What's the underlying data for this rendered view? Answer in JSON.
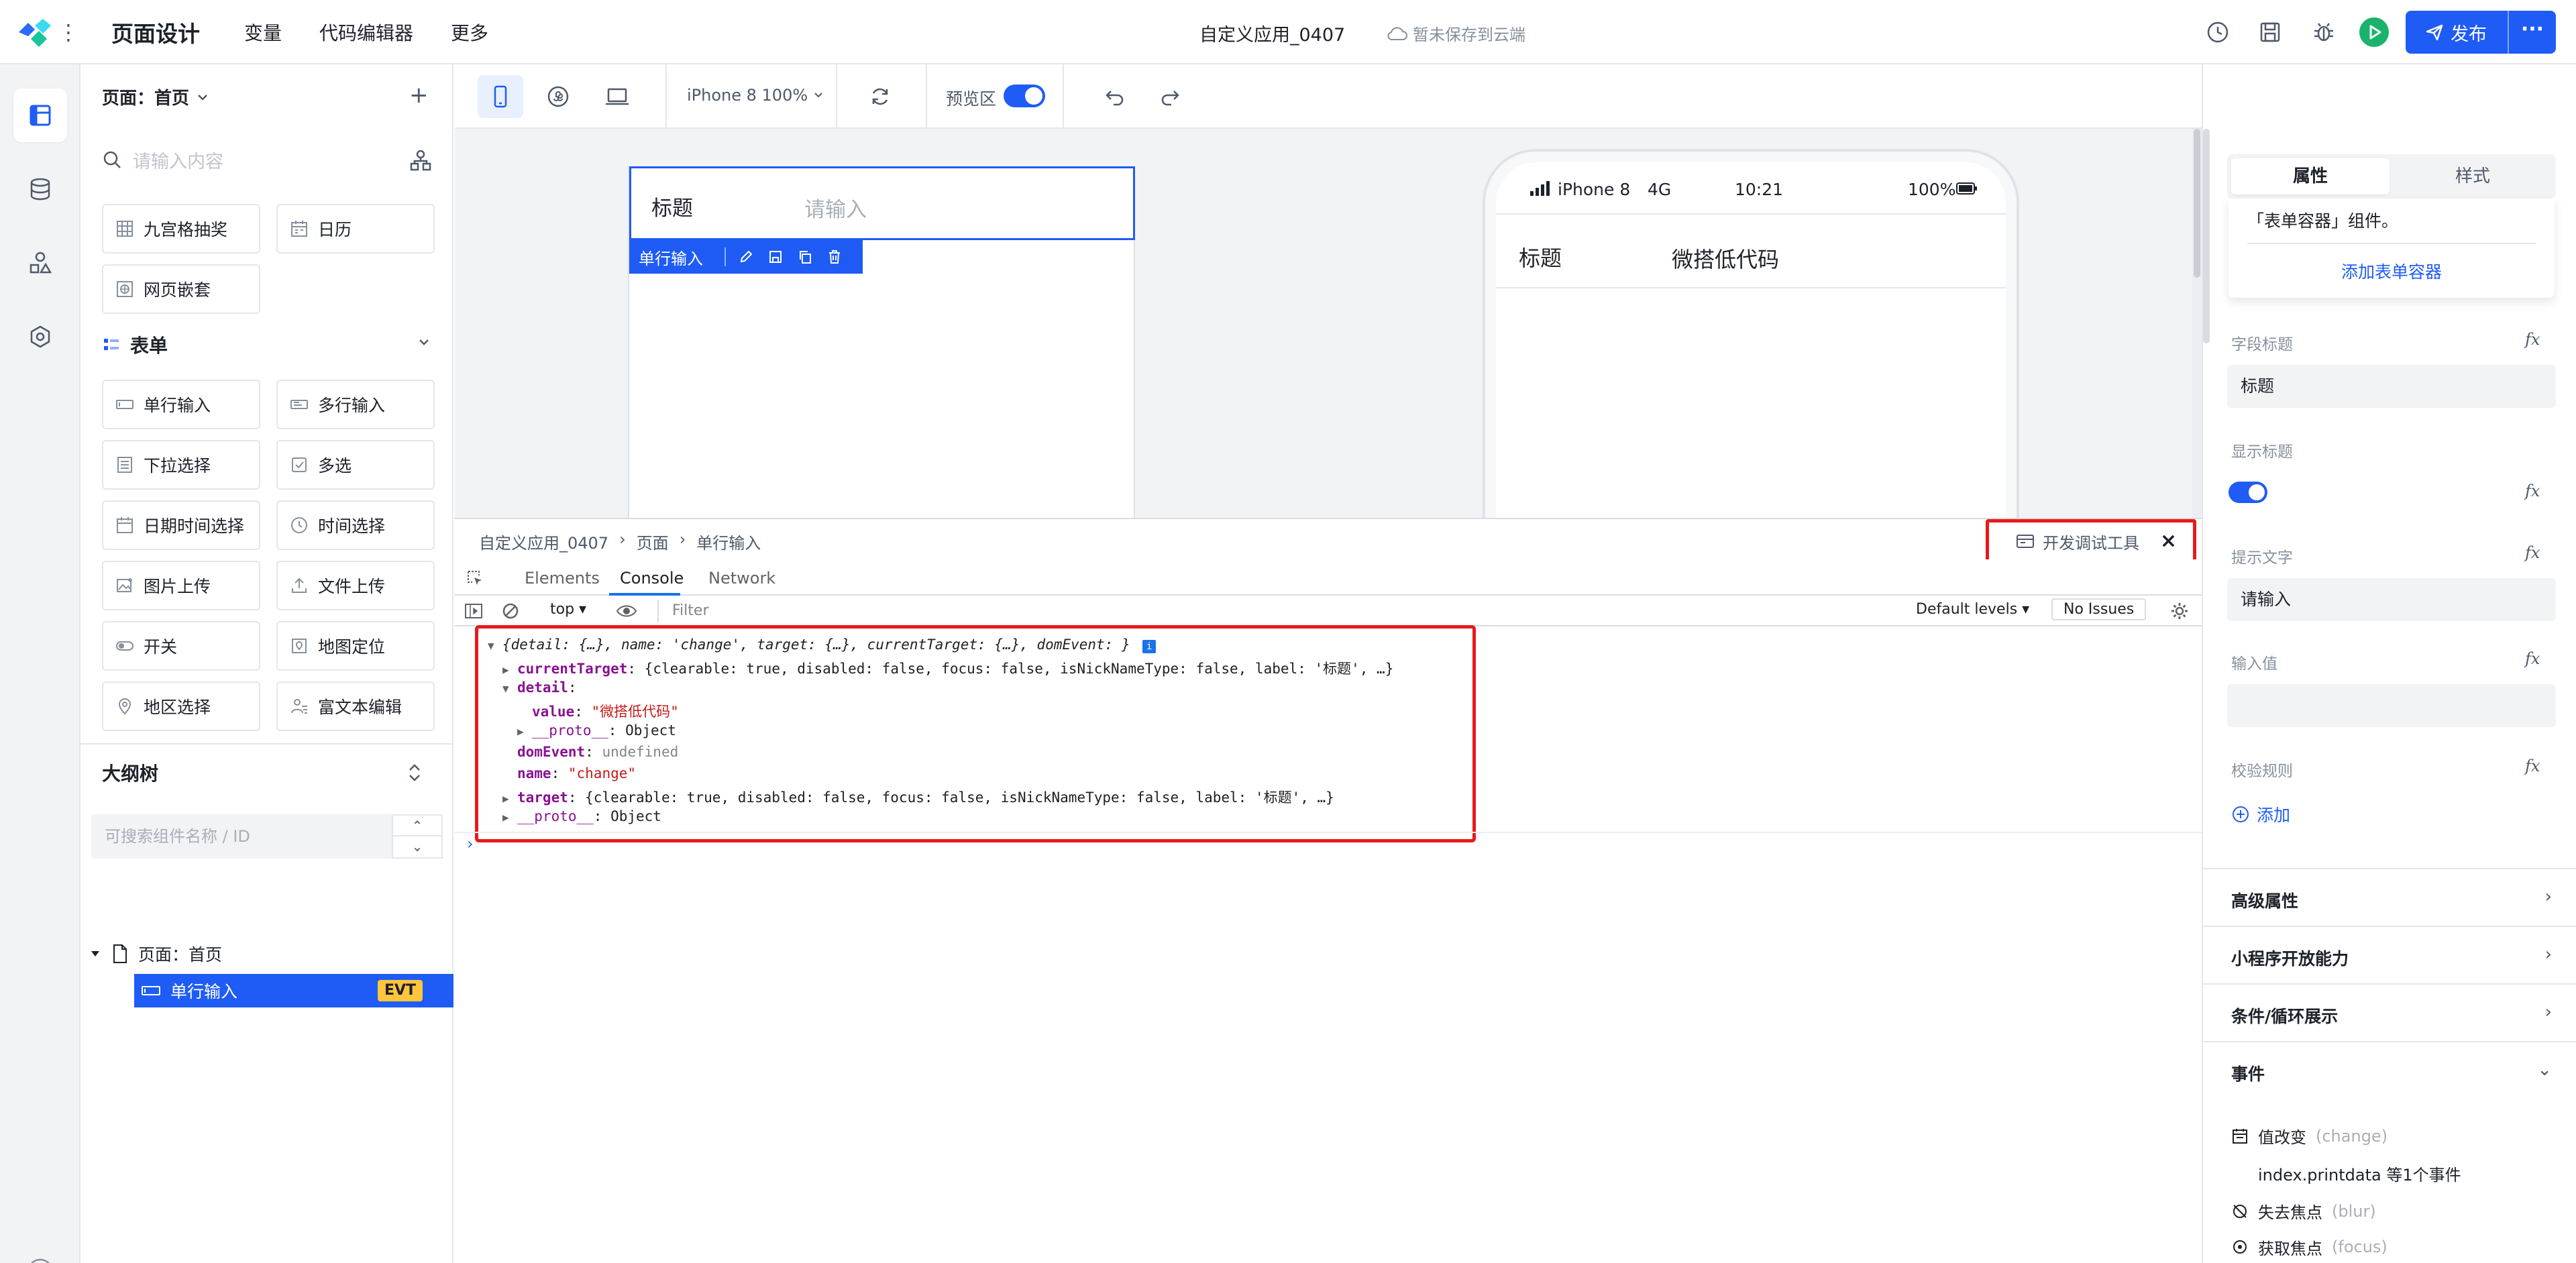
{
  "topbar": {
    "section_title": "页面设计",
    "nav": [
      "变量",
      "代码编辑器",
      "更多"
    ],
    "doc_title": "自定义应用_0407",
    "save_status": "暂未保存到云端",
    "publish_label": "发布",
    "publish_more": "···"
  },
  "left_panel": {
    "page_select": "页面：首页",
    "search_placeholder": "请输入内容",
    "components_top": [
      "九宫格抽奖",
      "日历",
      "网页嵌套"
    ],
    "group_form": "表单",
    "form_components": [
      "单行输入",
      "多行输入",
      "下拉选择",
      "多选",
      "日期时间选择",
      "时间选择",
      "图片上传",
      "文件上传",
      "开关",
      "地图定位",
      "地区选择",
      "富文本编辑"
    ],
    "outline_title": "大纲树",
    "outline_search_placeholder": "可搜索组件名称 / ID",
    "tree_page": "页面：首页",
    "tree_item": "单行输入",
    "tree_item_badge": "EVT"
  },
  "canvas_toolbar": {
    "device": "iPhone 8 100%",
    "preview_label": "预览区"
  },
  "canvas": {
    "field_title": "标题",
    "field_placeholder": "请输入",
    "selected_tag": "单行输入",
    "phone_status": {
      "device": "iPhone 8",
      "network": "4G",
      "time": "10:21",
      "battery": "100%"
    },
    "phone_label": "标题",
    "phone_value": "微搭低代码"
  },
  "devtools": {
    "breadcrumb": [
      "自定义应用_0407",
      "页面",
      "单行输入"
    ],
    "title": "开发调试工具",
    "tabs": [
      "Elements",
      "Console",
      "Network"
    ],
    "context": "top",
    "filter_placeholder": "Filter",
    "levels": "Default levels",
    "issues": "No Issues",
    "console": {
      "summary": "{detail: {…}, name: 'change', target: {…}, currentTarget: {…}, domEvent: }",
      "current_target_key": "currentTarget",
      "current_target_val": "{clearable: true, disabled: false, focus: false, isNickNameType: false, label: '标题', …}",
      "detail_key": "detail",
      "value_key": "value",
      "value_val": "\"微搭低代码\"",
      "proto_key": "__proto__",
      "proto_val": "Object",
      "dom_event_key": "domEvent",
      "dom_event_val": "undefined",
      "name_key": "name",
      "name_val": "\"change\"",
      "target_key": "target",
      "target_val": "{clearable: true, disabled: false, focus: false, isNickNameType: false, label: '标题', …}"
    }
  },
  "right_panel": {
    "tabs": [
      "属性",
      "样式"
    ],
    "tip_text": "「表单容器」组件。",
    "tip_link": "添加表单容器",
    "field_title_label": "字段标题",
    "field_title_value": "标题",
    "show_title_label": "显示标题",
    "hint_label": "提示文字",
    "hint_value": "请输入",
    "input_value_label": "输入值",
    "rules_label": "校验规则",
    "add_label": "添加",
    "fx": "fx",
    "sections": [
      "高级属性",
      "小程序开放能力",
      "条件/循环展示",
      "事件"
    ],
    "events": [
      {
        "name": "值改变",
        "code": "(change)"
      },
      {
        "name": "失去焦点",
        "code": "(blur)"
      },
      {
        "name": "获取焦点",
        "code": "(focus)"
      }
    ],
    "event_handler": "index.printdata 等1个事件"
  },
  "colors": {
    "primary": "#1f5cf5",
    "highlight": "#e8191b",
    "badge": "#ffc53d"
  }
}
